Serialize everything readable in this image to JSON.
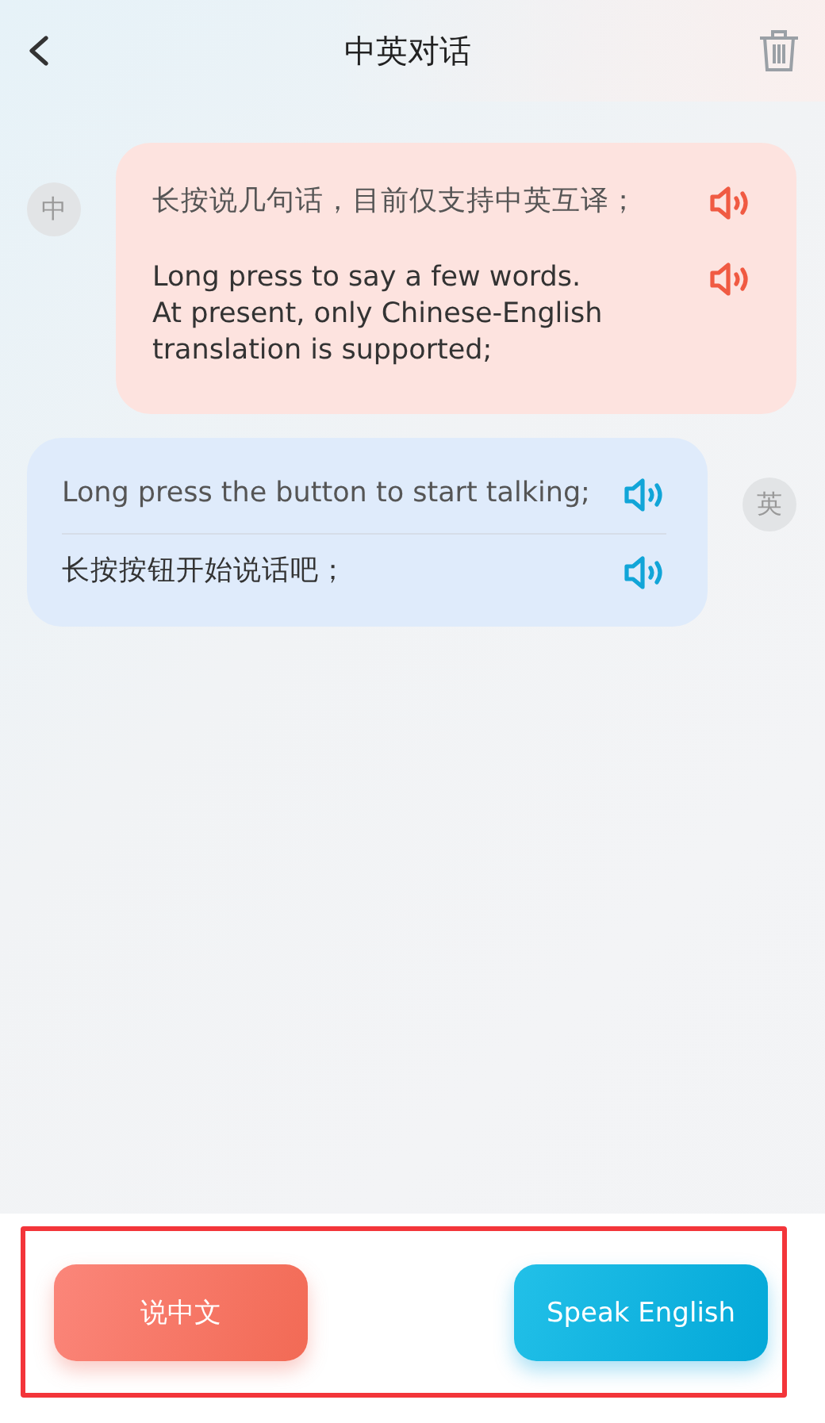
{
  "header": {
    "title": "中英对话"
  },
  "messages": [
    {
      "kind": "chinese",
      "avatar": "中",
      "lines": [
        "长按说几句话，目前仅支持中英互译；",
        "Long press to say a few words.\nAt present, only Chinese-English\ntranslation is supported;"
      ]
    },
    {
      "kind": "english",
      "avatar": "英",
      "lines": [
        "Long press the button to start talking;",
        "长按按钮开始说话吧；"
      ]
    }
  ],
  "buttons": [
    {
      "kind": "chinese",
      "label": "说中文"
    },
    {
      "kind": "english",
      "label": "Speak English"
    }
  ]
}
